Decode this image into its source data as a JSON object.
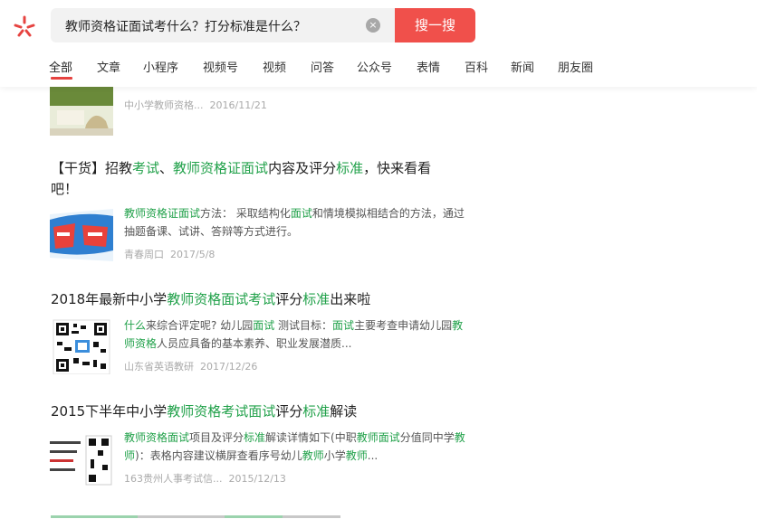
{
  "search": {
    "query": "教师资格证面试考什么？打分标准是什么？",
    "button_label": "搜一搜",
    "clear_glyph": "×"
  },
  "tabs": [
    "全部",
    "文章",
    "小程序",
    "视频号",
    "视频",
    "问答",
    "公众号",
    "表情",
    "百科",
    "新闻",
    "朋友圈"
  ],
  "active_tab_index": 0,
  "accent_color": "#f0504b",
  "highlight_color": "#21a14a",
  "results": [
    {
      "meta_source": "中小学教师资格...",
      "meta_date": "2016/11/21"
    },
    {
      "title_line1_pre": "【干货】招教",
      "title_line1_hl1": "考试",
      "title_line1_mid": "、",
      "title_line1_hl2": "教师资格证面试",
      "title_line1_post": "内容及评分",
      "title_line1_hl3": "标准",
      "title_line1_end": "，快来看看",
      "title_line2": "吧！",
      "snippet_hl1": "教师资格证面试",
      "snippet_t1": "方法： 采取结构化",
      "snippet_hl2": "面试",
      "snippet_t2": "和情境模拟相结合的方法，通过抽题备课、试讲、答辩等方式进行。",
      "meta_source": "青春周口",
      "meta_date": "2017/5/8"
    },
    {
      "title_pre": "2018年最新中小学",
      "title_hl1": "教师资格面试考试",
      "title_mid": "评分",
      "title_hl2": "标准",
      "title_post": "出来啦",
      "snippet_hl1": "什么",
      "snippet_t1": "来综合评定呢? 幼儿园",
      "snippet_hl2": "面试",
      "snippet_t2": " 测试目标：",
      "snippet_hl3": "面试",
      "snippet_t3": "主要考查申请幼儿园",
      "snippet_hl4": "教师资格",
      "snippet_t4": "人员应具备的基本素养、职业发展潜质...",
      "meta_source": "山东省英语教研",
      "meta_date": "2017/12/26"
    },
    {
      "title_pre": "2015下半年中小学",
      "title_hl1": "教师资格考试面试",
      "title_mid": "评分",
      "title_hl2": "标准",
      "title_post": "解读",
      "snippet_hl1": "教师资格面试",
      "snippet_t1": "项目及评分",
      "snippet_hl2": "标准",
      "snippet_t2": "解读详情如下(中职",
      "snippet_hl3": "教师面试",
      "snippet_t3": "分值同中学",
      "snippet_hl4": "教师",
      "snippet_t4": ")：表格内容建议横屏查看序号幼儿",
      "snippet_hl5": "教师",
      "snippet_t5": "小学",
      "snippet_hl6": "教师",
      "snippet_t6": "...",
      "meta_source": "163贵州人事考试信...",
      "meta_date": "2015/12/13"
    }
  ]
}
